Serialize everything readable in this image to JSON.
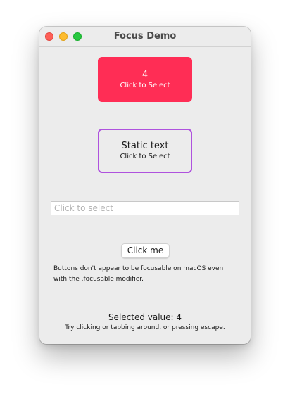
{
  "window": {
    "title": "Focus Demo"
  },
  "focus_card": {
    "value": "4",
    "caption": "Click to Select",
    "color": "#ff2d55"
  },
  "static_card": {
    "title": "Static text",
    "caption": "Click to Select",
    "border_color": "#af52de"
  },
  "text_field": {
    "value": "",
    "placeholder": "Click to select"
  },
  "button": {
    "label": "Click me"
  },
  "note": "Buttons don't appear to be focusable on macOS even with the .focusable modifier.",
  "status": {
    "selected_value": "Selected value: 4",
    "hint": "Try clicking or tabbing around, or pressing escape."
  },
  "icons": [
    "close-button",
    "minimize-button",
    "zoom-button"
  ]
}
